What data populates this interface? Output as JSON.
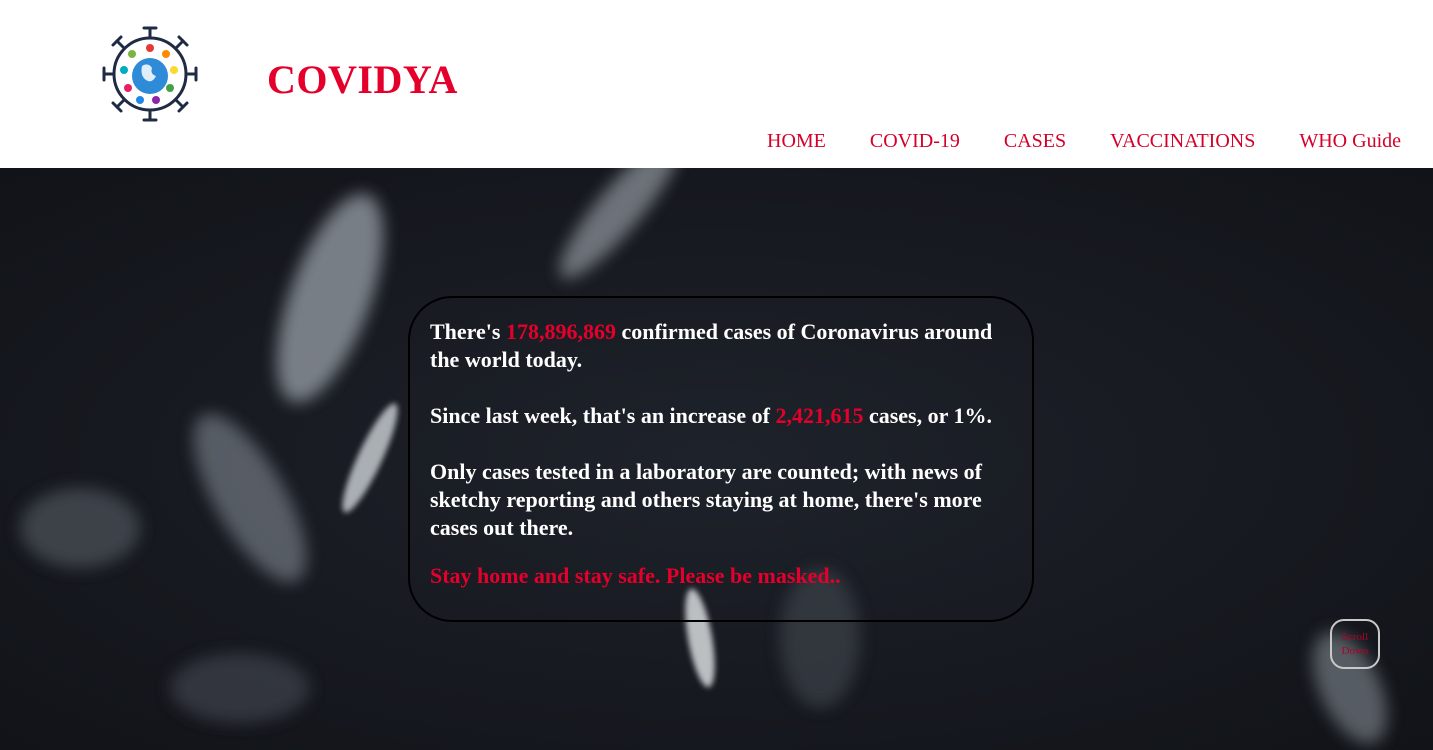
{
  "header": {
    "brand": "COVIDYA",
    "logo_icon": "virus-globe-logo-icon",
    "nav": [
      "HOME",
      "COVID-19",
      "CASES",
      "VACCINATIONS",
      "WHO Guide"
    ]
  },
  "hero": {
    "line1_pre": "There's ",
    "confirmed_cases": "178,896,869",
    "line1_post": " confirmed cases of Coronavirus around the world today.",
    "line2_pre": "Since last week, that's an increase of ",
    "weekly_increase": "2,421,615",
    "line2_post": " cases, or 1%.",
    "line3": "Only cases tested in a laboratory are counted; with news of sketchy reporting and others staying at home, there's more cases out there.",
    "safety_message": "Stay home and stay safe. Please be masked..",
    "scroll_label": "Scroll Down"
  },
  "colors": {
    "accent": "#e4002b",
    "hero_background": "#181b22",
    "card_border": "#000000"
  }
}
